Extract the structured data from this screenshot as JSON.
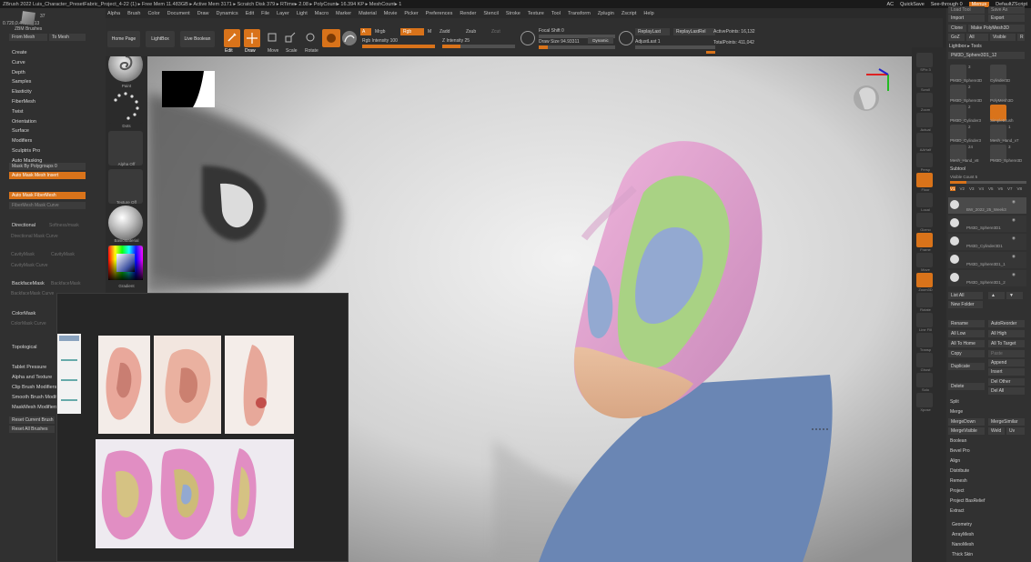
{
  "titlebar": {
    "text": "ZBrush 2022   Luis_Character_PresetFabric_Project_4-22 (1)   ▸ Free Mem 11.483GB ▸ Active Mem 3171 ▸ Scratch Disk 379 ▸ RTime▸ 2.08 ▸ PolyCount▸ 16.394 KP ▸ MeshCount▸ 1",
    "ac": "AC",
    "quicksave": "QuickSave",
    "seethrough": "See-through  0",
    "menus": "Menus",
    "default_script": "DefaultZScript"
  },
  "menubar": [
    "Alpha",
    "Brush",
    "Color",
    "Document",
    "Draw",
    "Dynamics",
    "Edit",
    "File",
    "Layer",
    "Light",
    "Macro",
    "Marker",
    "Material",
    "Movie",
    "Picker",
    "Preferences",
    "Render",
    "Stencil",
    "Stroke",
    "Texture",
    "Tool",
    "Transform",
    "Zplugin",
    "Zscript",
    "Help"
  ],
  "left_panel": {
    "coords": "0.720,0.443,0.213",
    "logo_label": "ZBM Brushes",
    "logo_count": "37",
    "from_mesh": "From Mesh",
    "to_mesh": "To Mesh",
    "items": [
      "Create",
      "Curve",
      "Depth",
      "Samples",
      "Elasticity",
      "FiberMesh",
      "Twist",
      "Orientation",
      "Surface",
      "Modifiers",
      "Sculptris Pro",
      "Auto Masking"
    ],
    "mask_by_polygroups": "Mask By Polygroups 0",
    "auto_mask_mesh_insert": "Auto Mask Mesh Insert",
    "auto_mask_fibermesh": "Auto Mask FiberMesh",
    "fibermesh_mask_curve": "FiberMesh Mask Curve",
    "directional": "Directional",
    "directional_value": "Softness/mask",
    "directional_curve": "Directional Mask Curve",
    "cavity_mask": "CavityMask",
    "cavity_mask_curve": "CavityMask Curve",
    "backface_mask": "BackfaceMask",
    "backface_mask_curve": "BackfaceMask Curve",
    "color_mask": "ColorMask",
    "color_mask_curve": "ColorMask Curve",
    "topological": "Topological",
    "tablet_pressure": "Tablet Pressure",
    "alpha_and_texture": "Alpha and Texture",
    "clip_brush_modifiers": "Clip Brush Modifiers",
    "smooth_brush_modifiers": "Smooth Brush Modifiers",
    "maskmesh_modifiers": "MaskMesh Modifiers",
    "reset_current_brush": "Reset Current Brush",
    "reset_all_brushes": "Reset All Brushes"
  },
  "brush_column": {
    "labels": [
      "Paint",
      "Dots",
      "Alpha Off",
      "Texture Off",
      "BasicMaterial",
      "Gradient"
    ]
  },
  "top_toolbar": {
    "home_page": "Home Page",
    "lightbox": "LightBox",
    "live_boolean": "Live Boolean",
    "edit": "Edit",
    "draw": "Draw",
    "move": "Move",
    "scale": "Scale",
    "rotate": "Rotate",
    "a_label": "A",
    "mrgb": "Mrgb",
    "rgb": "Rgb",
    "m": "M",
    "zadd": "Zadd",
    "zsub": "Zsub",
    "zcut": "Zcut",
    "rgb_intensity": "Rgb Intensity 100",
    "z_intensity": "Z Intensity 25",
    "focal_shift": "Focal Shift 0",
    "draw_size": "Draw Size 94.93311",
    "dynamic": "Dynamic",
    "replay_last": "ReplayLast",
    "replay_last_rel": "ReplayLastRel",
    "active_points": "ActivePoints: 16,132",
    "adjust_last": "AdjustLast  1",
    "total_points": "TotalPoints: 411,042",
    "rgb_intensity_level": 1.0,
    "z_intensity_level": 0.25,
    "draw_size_level": 0.12
  },
  "right_shelf": {
    "labels": [
      "SPix 3",
      "Scroll",
      "Zoom",
      "Actual",
      "AAHalf",
      "Persp",
      "Floor",
      "Local",
      "Gizmo",
      "Frame",
      "Move",
      "Zoom3D",
      "Rotate",
      "Line Fill",
      "Transp",
      "Ghost",
      "Solo",
      "Xpose"
    ],
    "orange_index": [
      6,
      9,
      11,
      19
    ]
  },
  "right_panel": {
    "load_tool": "Load Tool",
    "save_as": "Save As",
    "import": "Import",
    "export": "Export",
    "clone": "Clone",
    "make_polymesh": "Make PolyMesh3D",
    "goz": "GoZ",
    "all": "All",
    "visible": "Visible",
    "r": "R",
    "lightbox_tools": "Lightbox ▸ Tools",
    "current_tool": "PM3D_Sphere3D1_12",
    "tools": [
      {
        "name": "PM3D_Sphere3D",
        "count": "3"
      },
      {
        "name": "Cylinder3D",
        "count": ""
      },
      {
        "name": "PM3D_Sphere3D",
        "count": "2"
      },
      {
        "name": "PolyMesh3D",
        "count": ""
      },
      {
        "name": "PM3D_Cylinder3",
        "count": "2"
      },
      {
        "name": "SimpleBrush",
        "count": ""
      },
      {
        "name": "PM3D_Cylinder3",
        "count": "2"
      },
      {
        "name": "Mesh_Hand_v7",
        "count": "1"
      },
      {
        "name": "Mesh_Hand_v8",
        "count": "24"
      },
      {
        "name": "PM3D_Sphere3D",
        "count": "3"
      }
    ],
    "subtool": "Subtool",
    "visible_count": "Visible Count 5",
    "v_tabs": [
      "V1",
      "V2",
      "V3",
      "V4",
      "V5",
      "V6",
      "V7",
      "V8"
    ],
    "subtools": [
      "BW_2022_25_Week3",
      "PM3D_Sphere3D1",
      "PM3D_Cylinder3D1",
      "PM3D_Sphere3D1_1",
      "PM3D_Sphere3D1_2"
    ],
    "list_all": "List All",
    "new_folder": "New Folder",
    "rename": "Rename",
    "auto_reorder": "AutoReorder",
    "all_low": "All Low",
    "all_high": "All High",
    "all_to_home": "All To Home",
    "all_to_target": "All To Target",
    "copy": "Copy",
    "paste": "Paste",
    "duplicate": "Duplicate",
    "append": "Append",
    "insert": "Insert",
    "delete": "Delete",
    "del_other": "Del Other",
    "del_all": "Del All",
    "split": "Split",
    "merge": "Merge",
    "merge_down": "MergeDown",
    "merge_similar": "MergeSimilar",
    "merge_visible": "MergeVisible",
    "weld": "Weld",
    "uv": "Uv",
    "boolean": "Boolean",
    "bevel_pro": "Bevel Pro",
    "align": "Align",
    "distribute": "Distribute",
    "remesh": "Remesh",
    "project": "Project",
    "project_bas_relief": "Project BasRelief",
    "extract": "Extract",
    "geometry": "Geometry",
    "array_mesh": "ArrayMesh",
    "nano_mesh": "NanoMesh",
    "thick_skin": "Thick Skin"
  },
  "colors": {
    "accent": "#d9731a",
    "panel": "#303030",
    "ear_pink": "#e7a9d6",
    "ear_green": "#a9d284",
    "ear_blue": "#93a9d1",
    "skin": "#e7bc9a",
    "shoulder_blue": "#6a86b4"
  }
}
